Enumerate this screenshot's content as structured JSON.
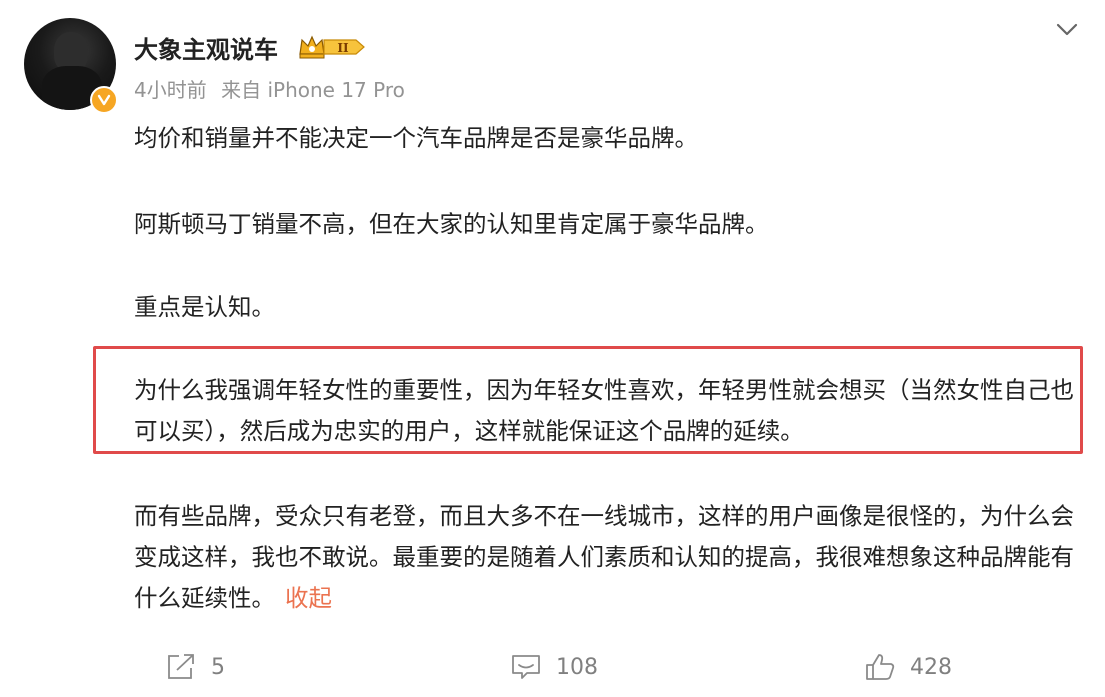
{
  "post": {
    "username": "大象主观说车",
    "meta": {
      "time": "4小时前",
      "source": "来自 iPhone 17 Pro"
    },
    "level_badge": "II",
    "paragraphs": [
      "均价和销量并不能决定一个汽车品牌是否是豪华品牌。",
      "阿斯顿马丁销量不高，但在大家的认知里肯定属于豪华品牌。",
      "重点是认知。",
      "为什么我强调年轻女性的重要性，因为年轻女性喜欢，年轻男性就会想买（当然女性自己也可以买），然后成为忠实的用户，这样就能保证这个品牌的延续。",
      "而有些品牌，受众只有老登，而且大多不在一线城市，这样的用户画像是很怪的，为什么会变成这样，我也不敢说。最重要的是随着人们素质和认知的提高，我很难想象这种品牌能有什么延续性。"
    ],
    "collapse_label": "收起",
    "highlight_color": "#e04a4a",
    "accent_color": "#eb7350"
  },
  "actions": {
    "share": {
      "icon": "share-icon",
      "count": "5"
    },
    "comment": {
      "icon": "comment-icon",
      "count": "108"
    },
    "like": {
      "icon": "thumbs-up-icon",
      "count": "428"
    }
  },
  "icons": {
    "chevron": "chevron-down-icon",
    "verify": "verified-v-icon",
    "crown": "crown-icon"
  }
}
